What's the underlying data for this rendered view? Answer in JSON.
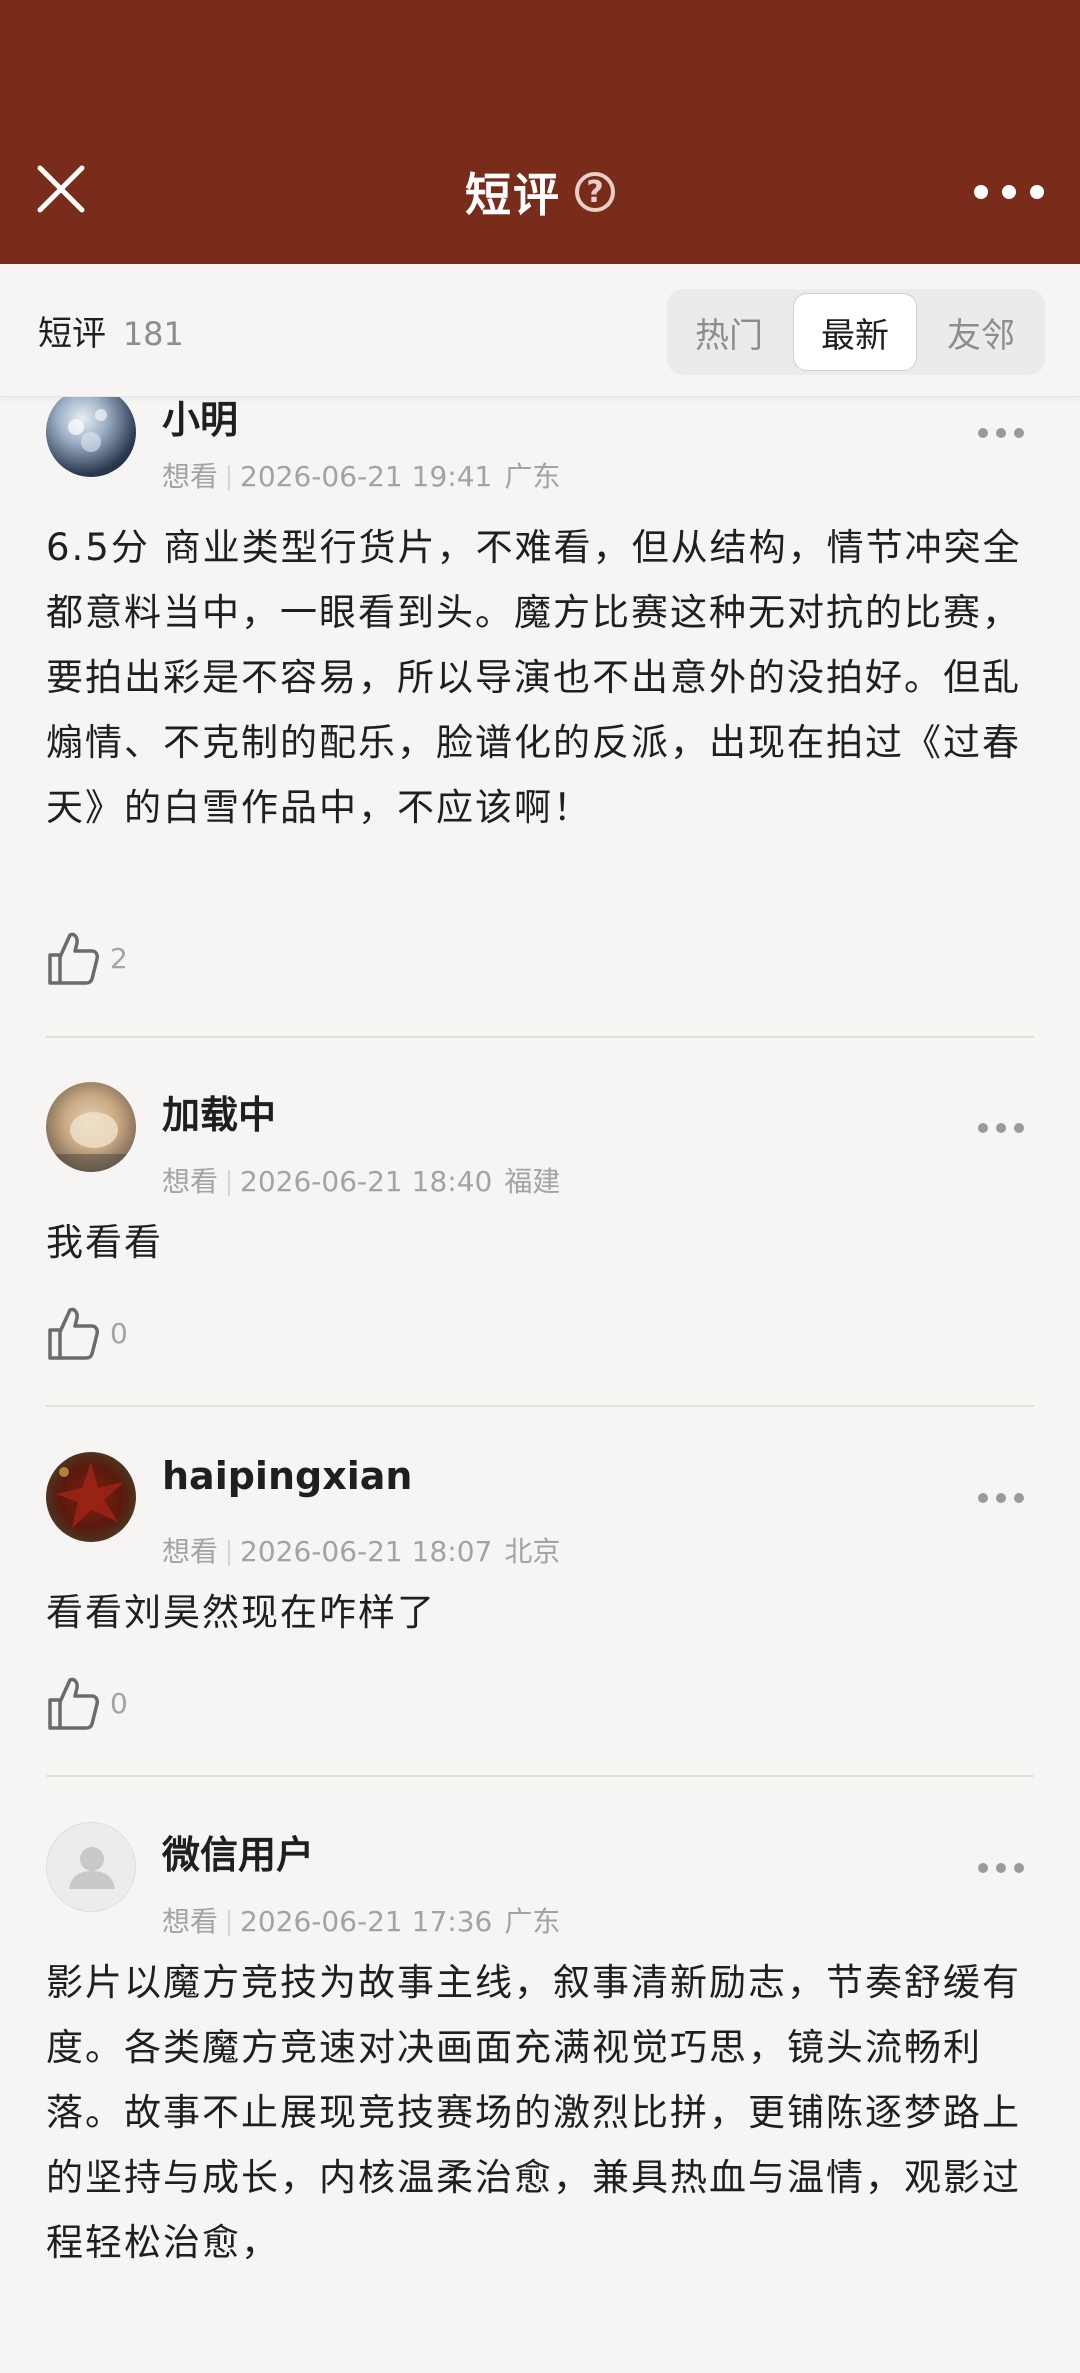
{
  "header": {
    "title": "短评",
    "help_glyph": "?",
    "close_icon": "close-icon",
    "more_icon": "more-horizontal-icon",
    "background": "#782c19"
  },
  "subbar": {
    "label": "短评",
    "count": "181",
    "tabs": [
      {
        "label": "热门",
        "active": false
      },
      {
        "label": "最新",
        "active": true
      },
      {
        "label": "友邻",
        "active": false
      }
    ]
  },
  "comments": [
    {
      "username": "小明",
      "status": "想看",
      "time": "2026-06-21 19:41",
      "location": "广东",
      "text": "6.5分 商业类型行货片，不难看，但从结构，情节冲突全都意料当中，一眼看到头。魔方比赛这种无对抗的比赛，要拍出彩是不容易，所以导演也不出意外的没拍好。但乱煽情、不克制的配乐，脸谱化的反派，出现在拍过《过春天》的白雪作品中，不应该啊！",
      "likes": "2"
    },
    {
      "username": "加载中",
      "status": "想看",
      "time": "2026-06-21 18:40",
      "location": "福建",
      "text": "我看看",
      "likes": "0"
    },
    {
      "username": "haipingxian",
      "status": "想看",
      "time": "2026-06-21 18:07",
      "location": "北京",
      "text": "看看刘昊然现在咋样了",
      "likes": "0"
    },
    {
      "username": "微信用户",
      "status": "想看",
      "time": "2026-06-21 17:36",
      "location": "广东",
      "text": "影片以魔方竞技为故事主线，叙事清新励志，节奏舒缓有度。各类魔方竞速对决画面充满视觉巧思，镜头流畅利落。故事不止展现竞技赛场的激烈比拼，更铺陈逐梦路上的坚持与成长，内核温柔治愈，兼具热血与温情，观影过程轻松治愈，"
    }
  ]
}
